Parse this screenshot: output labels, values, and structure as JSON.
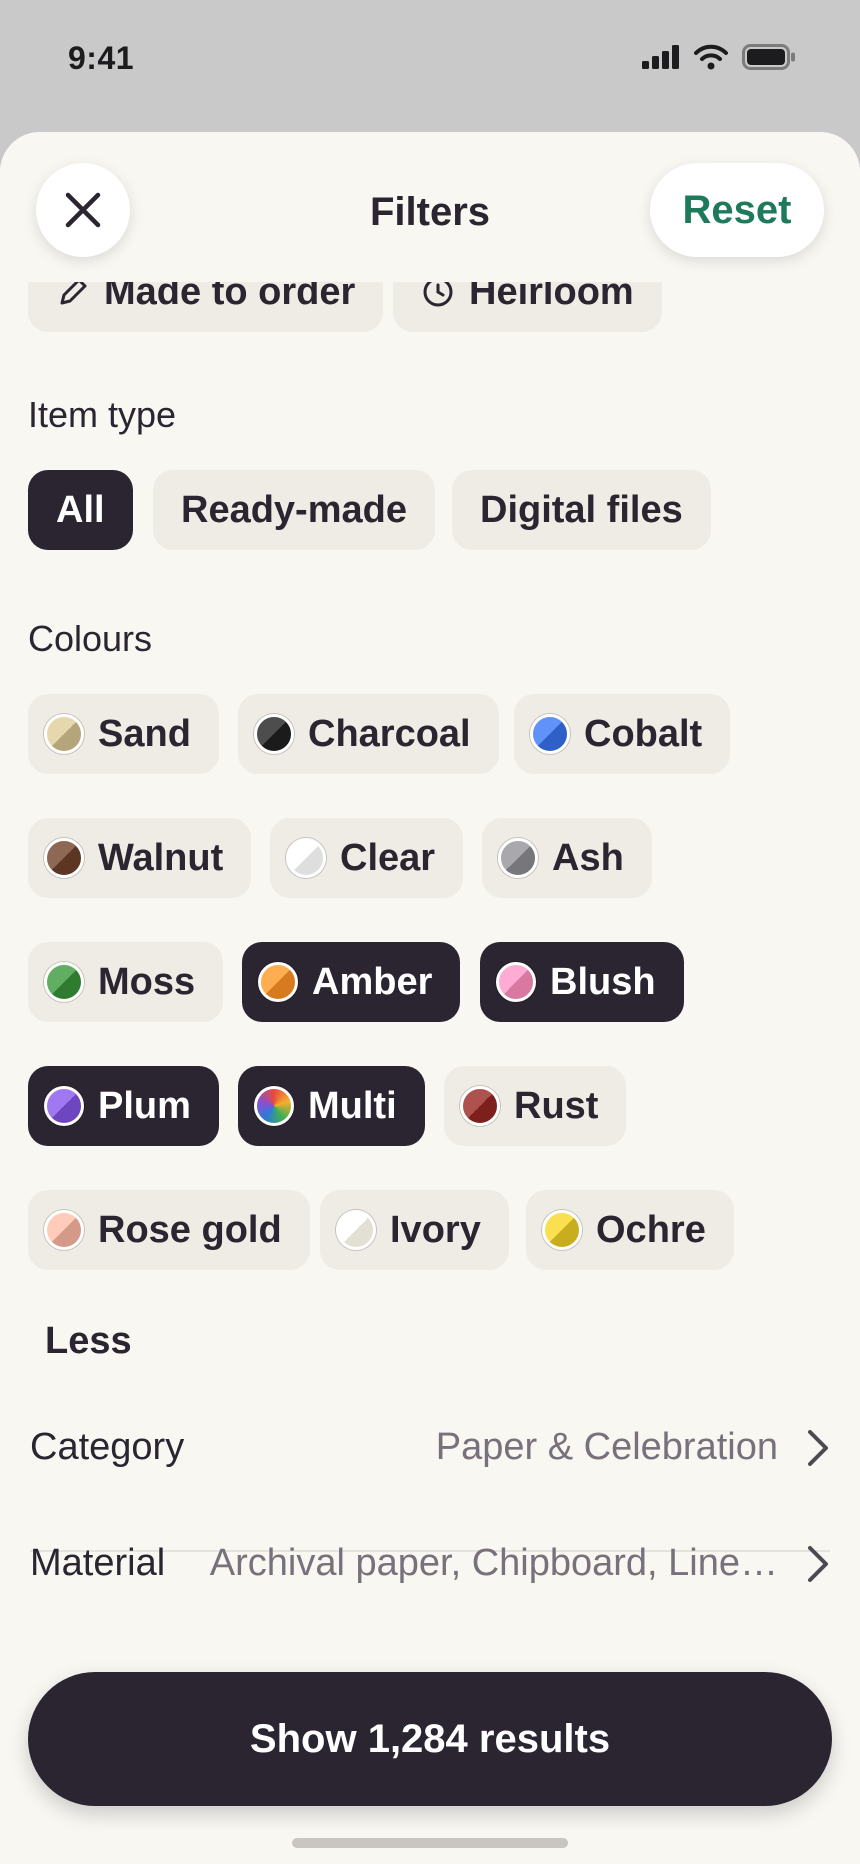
{
  "status_bar": {
    "time": "9:41"
  },
  "header": {
    "title": "Filters",
    "reset_label": "Reset"
  },
  "special_chips": [
    {
      "label": "Made to order",
      "icon": "pencil-icon"
    },
    {
      "label": "Heirloom",
      "icon": "clock-icon"
    }
  ],
  "item_type": {
    "label": "Item type",
    "options": [
      {
        "label": "All",
        "selected": true
      },
      {
        "label": "Ready-made",
        "selected": false
      },
      {
        "label": "Digital files",
        "selected": false
      }
    ]
  },
  "colours": {
    "label": "Colours",
    "options": [
      {
        "label": "Sand",
        "selected": false,
        "color": "#c4b48a"
      },
      {
        "label": "Charcoal",
        "selected": false,
        "color": "#2a2a2a"
      },
      {
        "label": "Cobalt",
        "selected": false,
        "color": "#3d6fd6"
      },
      {
        "label": "Walnut",
        "selected": false,
        "color": "#6b4532"
      },
      {
        "label": "Clear",
        "selected": false,
        "color": "#ededed"
      },
      {
        "label": "Ash",
        "selected": false,
        "color": "#85858a"
      },
      {
        "label": "Moss",
        "selected": false,
        "color": "#3e8a3e"
      },
      {
        "label": "Amber",
        "selected": true,
        "color": "#e58a2e"
      },
      {
        "label": "Blush",
        "selected": true,
        "color": "#e888b0"
      },
      {
        "label": "Plum",
        "selected": true,
        "color": "#7d55cf"
      },
      {
        "label": "Multi",
        "selected": true,
        "color": "multicolor"
      },
      {
        "label": "Rust",
        "selected": false,
        "color": "#8c2f2a"
      },
      {
        "label": "Rose gold",
        "selected": false,
        "color": "#e3a898"
      },
      {
        "label": "Ivory",
        "selected": false,
        "color": "#f1eee2"
      },
      {
        "label": "Ochre",
        "selected": false,
        "color": "#d7bd2e"
      }
    ],
    "less_label": "Less"
  },
  "rows": [
    {
      "label": "Category",
      "value": "Paper & Celebration"
    },
    {
      "label": "Material",
      "value": "Archival paper, Chipboard, Line…"
    }
  ],
  "show_results_label": "Show 1,284 results",
  "colors": {
    "accent": "#1f7a5c",
    "dark": "#2a2530",
    "chip": "#efebe5",
    "background": "#f9f7f2"
  }
}
